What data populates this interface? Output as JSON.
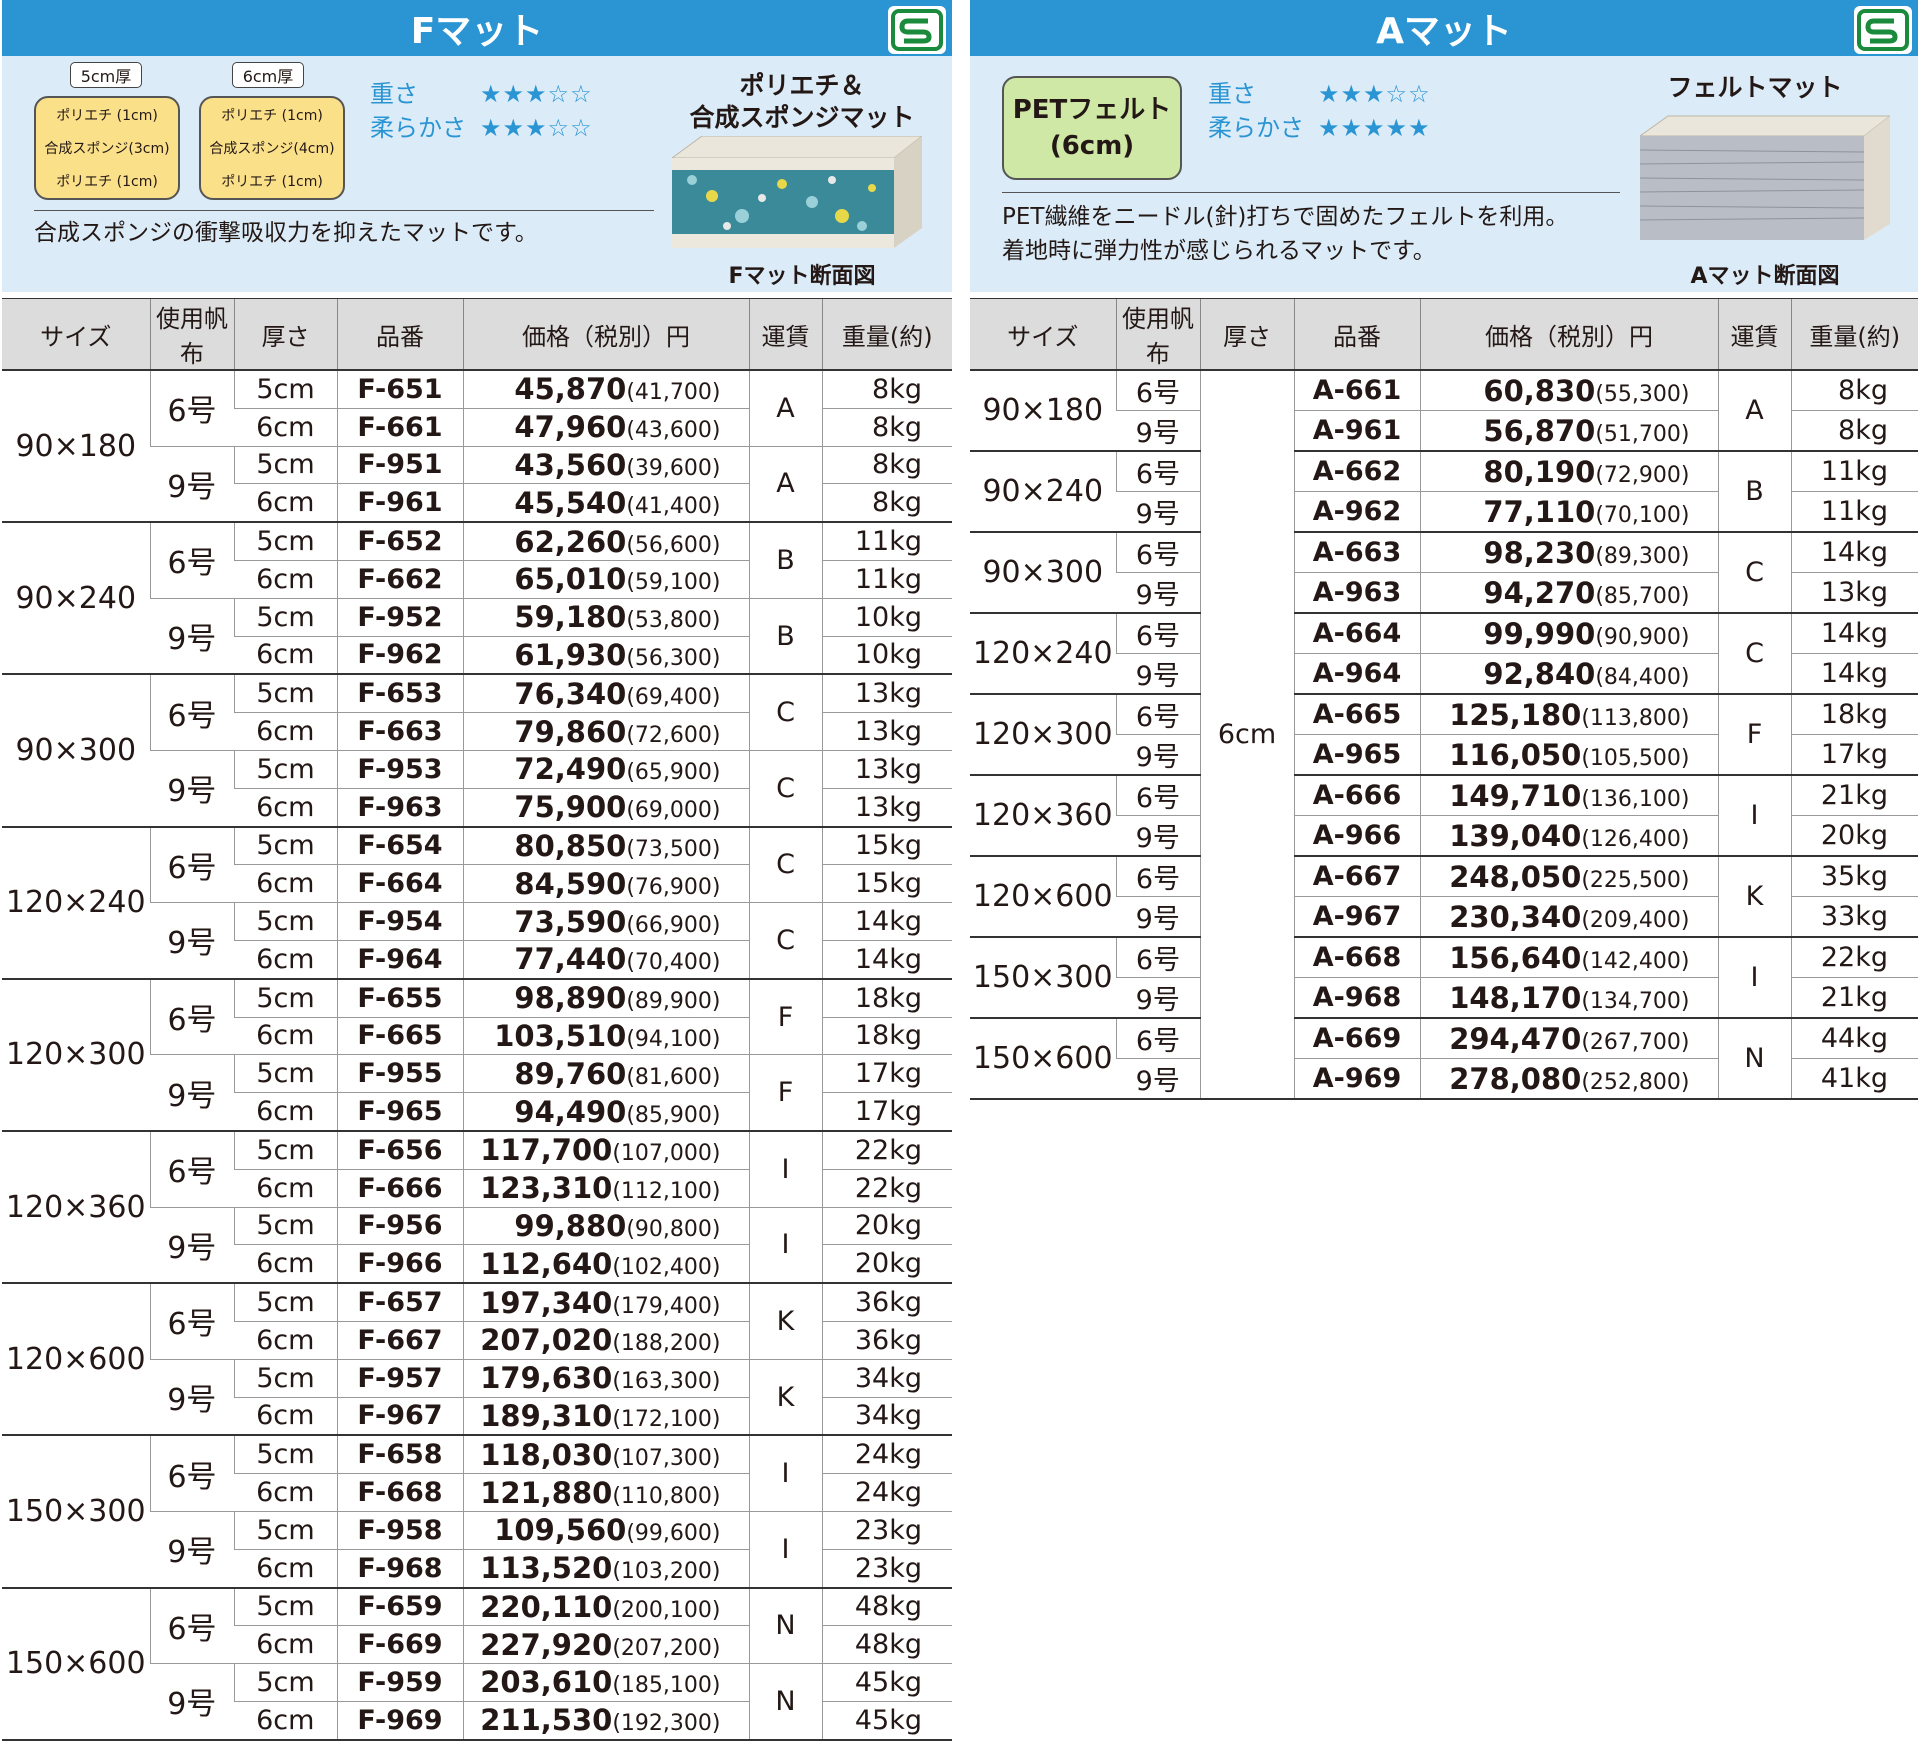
{
  "brand_colors": {
    "title_bar": "#2b95d4",
    "info_bg": "#dbecf8",
    "pill_f": "#fbe08a",
    "pill_a": "#cfe8a6",
    "header_bg": "#dcdcdc"
  },
  "logo_icon": "s-mark-icon",
  "f_mat": {
    "title": "Fマット",
    "thickness_5": "5cm厚",
    "thickness_6": "6cm厚",
    "layers_5": [
      "ポリエチ (1cm)",
      "合成スポンジ(3cm)",
      "ポリエチ (1cm)"
    ],
    "layers_6": [
      "ポリエチ (1cm)",
      "合成スポンジ(4cm)",
      "ポリエチ (1cm)"
    ],
    "weight_label": "重さ",
    "weight_stars": "★★★☆☆",
    "softness_label": "柔らかさ",
    "softness_stars": "★★★☆☆",
    "description": "合成スポンジの衝撃吸収力を抑えたマットです。",
    "image_title_1": "ポリエチ＆",
    "image_title_2": "合成スポンジマット",
    "image_caption": "Fマット断面図",
    "headers": [
      "サイズ",
      "使用帆布",
      "厚さ",
      "品番",
      "価格（税別）円",
      "運賃",
      "重量(約)"
    ],
    "groups": [
      {
        "size": "90×180",
        "subs": [
          {
            "canvas": "6号",
            "fare": "A",
            "rows": [
              [
                "5cm",
                "F-651",
                "45,870",
                "(41,700)",
                "8kg"
              ],
              [
                "6cm",
                "F-661",
                "47,960",
                "(43,600)",
                "8kg"
              ]
            ]
          },
          {
            "canvas": "9号",
            "fare": "A",
            "rows": [
              [
                "5cm",
                "F-951",
                "43,560",
                "(39,600)",
                "8kg"
              ],
              [
                "6cm",
                "F-961",
                "45,540",
                "(41,400)",
                "8kg"
              ]
            ]
          }
        ]
      },
      {
        "size": "90×240",
        "subs": [
          {
            "canvas": "6号",
            "fare": "B",
            "rows": [
              [
                "5cm",
                "F-652",
                "62,260",
                "(56,600)",
                "11kg"
              ],
              [
                "6cm",
                "F-662",
                "65,010",
                "(59,100)",
                "11kg"
              ]
            ]
          },
          {
            "canvas": "9号",
            "fare": "B",
            "rows": [
              [
                "5cm",
                "F-952",
                "59,180",
                "(53,800)",
                "10kg"
              ],
              [
                "6cm",
                "F-962",
                "61,930",
                "(56,300)",
                "10kg"
              ]
            ]
          }
        ]
      },
      {
        "size": "90×300",
        "subs": [
          {
            "canvas": "6号",
            "fare": "C",
            "rows": [
              [
                "5cm",
                "F-653",
                "76,340",
                "(69,400)",
                "13kg"
              ],
              [
                "6cm",
                "F-663",
                "79,860",
                "(72,600)",
                "13kg"
              ]
            ]
          },
          {
            "canvas": "9号",
            "fare": "C",
            "rows": [
              [
                "5cm",
                "F-953",
                "72,490",
                "(65,900)",
                "13kg"
              ],
              [
                "6cm",
                "F-963",
                "75,900",
                "(69,000)",
                "13kg"
              ]
            ]
          }
        ]
      },
      {
        "size": "120×240",
        "subs": [
          {
            "canvas": "6号",
            "fare": "C",
            "rows": [
              [
                "5cm",
                "F-654",
                "80,850",
                "(73,500)",
                "15kg"
              ],
              [
                "6cm",
                "F-664",
                "84,590",
                "(76,900)",
                "15kg"
              ]
            ]
          },
          {
            "canvas": "9号",
            "fare": "C",
            "rows": [
              [
                "5cm",
                "F-954",
                "73,590",
                "(66,900)",
                "14kg"
              ],
              [
                "6cm",
                "F-964",
                "77,440",
                "(70,400)",
                "14kg"
              ]
            ]
          }
        ]
      },
      {
        "size": "120×300",
        "subs": [
          {
            "canvas": "6号",
            "fare": "F",
            "rows": [
              [
                "5cm",
                "F-655",
                "98,890",
                "(89,900)",
                "18kg"
              ],
              [
                "6cm",
                "F-665",
                "103,510",
                "(94,100)",
                "18kg"
              ]
            ]
          },
          {
            "canvas": "9号",
            "fare": "F",
            "rows": [
              [
                "5cm",
                "F-955",
                "89,760",
                "(81,600)",
                "17kg"
              ],
              [
                "6cm",
                "F-965",
                "94,490",
                "(85,900)",
                "17kg"
              ]
            ]
          }
        ]
      },
      {
        "size": "120×360",
        "subs": [
          {
            "canvas": "6号",
            "fare": "I",
            "rows": [
              [
                "5cm",
                "F-656",
                "117,700",
                "(107,000)",
                "22kg"
              ],
              [
                "6cm",
                "F-666",
                "123,310",
                "(112,100)",
                "22kg"
              ]
            ]
          },
          {
            "canvas": "9号",
            "fare": "I",
            "rows": [
              [
                "5cm",
                "F-956",
                "99,880",
                "(90,800)",
                "20kg"
              ],
              [
                "6cm",
                "F-966",
                "112,640",
                "(102,400)",
                "20kg"
              ]
            ]
          }
        ]
      },
      {
        "size": "120×600",
        "subs": [
          {
            "canvas": "6号",
            "fare": "K",
            "rows": [
              [
                "5cm",
                "F-657",
                "197,340",
                "(179,400)",
                "36kg"
              ],
              [
                "6cm",
                "F-667",
                "207,020",
                "(188,200)",
                "36kg"
              ]
            ]
          },
          {
            "canvas": "9号",
            "fare": "K",
            "rows": [
              [
                "5cm",
                "F-957",
                "179,630",
                "(163,300)",
                "34kg"
              ],
              [
                "6cm",
                "F-967",
                "189,310",
                "(172,100)",
                "34kg"
              ]
            ]
          }
        ]
      },
      {
        "size": "150×300",
        "subs": [
          {
            "canvas": "6号",
            "fare": "I",
            "rows": [
              [
                "5cm",
                "F-658",
                "118,030",
                "(107,300)",
                "24kg"
              ],
              [
                "6cm",
                "F-668",
                "121,880",
                "(110,800)",
                "24kg"
              ]
            ]
          },
          {
            "canvas": "9号",
            "fare": "I",
            "rows": [
              [
                "5cm",
                "F-958",
                "109,560",
                "(99,600)",
                "23kg"
              ],
              [
                "6cm",
                "F-968",
                "113,520",
                "(103,200)",
                "23kg"
              ]
            ]
          }
        ]
      },
      {
        "size": "150×600",
        "subs": [
          {
            "canvas": "6号",
            "fare": "N",
            "rows": [
              [
                "5cm",
                "F-659",
                "220,110",
                "(200,100)",
                "48kg"
              ],
              [
                "6cm",
                "F-669",
                "227,920",
                "(207,200)",
                "48kg"
              ]
            ]
          },
          {
            "canvas": "9号",
            "fare": "N",
            "rows": [
              [
                "5cm",
                "F-959",
                "203,610",
                "(185,100)",
                "45kg"
              ],
              [
                "6cm",
                "F-969",
                "211,530",
                "(192,300)",
                "45kg"
              ]
            ]
          }
        ]
      }
    ]
  },
  "a_mat": {
    "title": "Aマット",
    "material_line1": "PETフェルト",
    "material_line2": "(6cm)",
    "weight_label": "重さ",
    "weight_stars": "★★★☆☆",
    "softness_label": "柔らかさ",
    "softness_stars": "★★★★★",
    "description_1": "PET繊維をニードル(針)打ちで固めたフェルトを利用。",
    "description_2": "着地時に弾力性が感じられるマットです。",
    "image_title": "フェルトマット",
    "image_caption": "Aマット断面図",
    "headers": [
      "サイズ",
      "使用帆布",
      "厚さ",
      "品番",
      "価格（税別）円",
      "運賃",
      "重量(約)"
    ],
    "thickness": "6cm",
    "groups": [
      {
        "size": "90×180",
        "fare": "A",
        "rows": [
          [
            "6号",
            "A-661",
            "60,830",
            "(55,300)",
            "8kg"
          ],
          [
            "9号",
            "A-961",
            "56,870",
            "(51,700)",
            "8kg"
          ]
        ]
      },
      {
        "size": "90×240",
        "fare": "B",
        "rows": [
          [
            "6号",
            "A-662",
            "80,190",
            "(72,900)",
            "11kg"
          ],
          [
            "9号",
            "A-962",
            "77,110",
            "(70,100)",
            "11kg"
          ]
        ]
      },
      {
        "size": "90×300",
        "fare": "C",
        "rows": [
          [
            "6号",
            "A-663",
            "98,230",
            "(89,300)",
            "14kg"
          ],
          [
            "9号",
            "A-963",
            "94,270",
            "(85,700)",
            "13kg"
          ]
        ]
      },
      {
        "size": "120×240",
        "fare": "C",
        "rows": [
          [
            "6号",
            "A-664",
            "99,990",
            "(90,900)",
            "14kg"
          ],
          [
            "9号",
            "A-964",
            "92,840",
            "(84,400)",
            "14kg"
          ]
        ]
      },
      {
        "size": "120×300",
        "fare": "F",
        "rows": [
          [
            "6号",
            "A-665",
            "125,180",
            "(113,800)",
            "18kg"
          ],
          [
            "9号",
            "A-965",
            "116,050",
            "(105,500)",
            "17kg"
          ]
        ]
      },
      {
        "size": "120×360",
        "fare": "I",
        "rows": [
          [
            "6号",
            "A-666",
            "149,710",
            "(136,100)",
            "21kg"
          ],
          [
            "9号",
            "A-966",
            "139,040",
            "(126,400)",
            "20kg"
          ]
        ]
      },
      {
        "size": "120×600",
        "fare": "K",
        "rows": [
          [
            "6号",
            "A-667",
            "248,050",
            "(225,500)",
            "35kg"
          ],
          [
            "9号",
            "A-967",
            "230,340",
            "(209,400)",
            "33kg"
          ]
        ]
      },
      {
        "size": "150×300",
        "fare": "I",
        "rows": [
          [
            "6号",
            "A-668",
            "156,640",
            "(142,400)",
            "22kg"
          ],
          [
            "9号",
            "A-968",
            "148,170",
            "(134,700)",
            "21kg"
          ]
        ]
      },
      {
        "size": "150×600",
        "fare": "N",
        "rows": [
          [
            "6号",
            "A-669",
            "294,470",
            "(267,700)",
            "44kg"
          ],
          [
            "9号",
            "A-969",
            "278,080",
            "(252,800)",
            "41kg"
          ]
        ]
      }
    ]
  }
}
